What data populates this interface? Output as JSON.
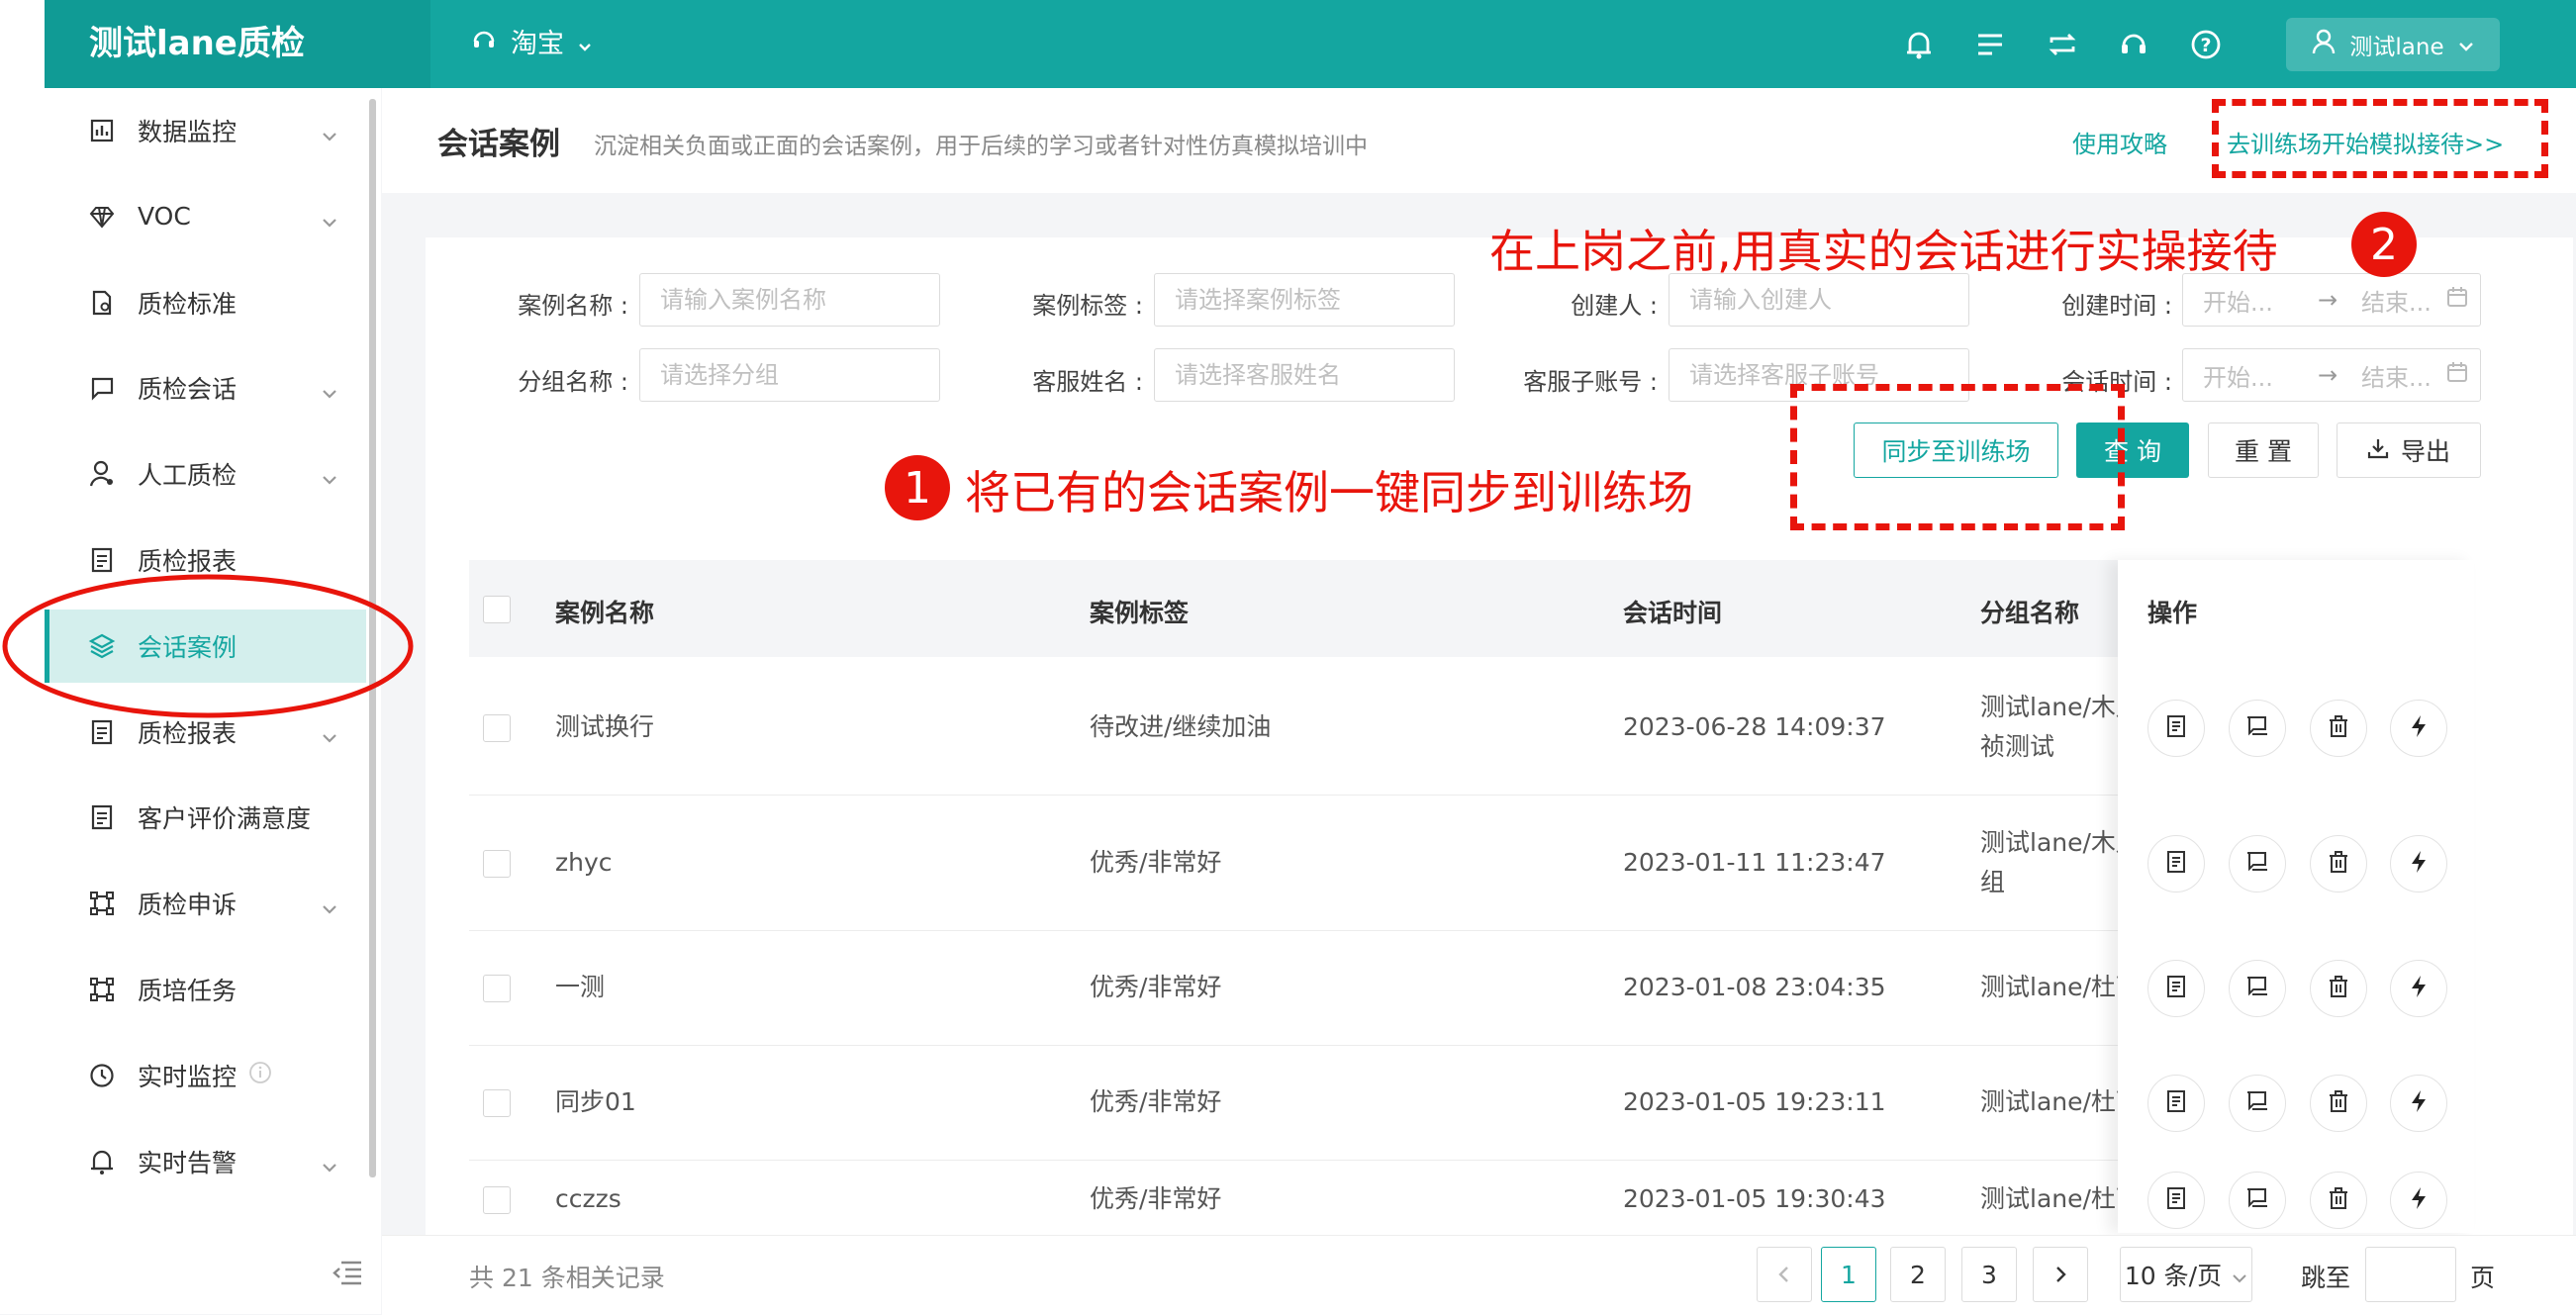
{
  "app": {
    "title": "测试lane质检",
    "store": "淘宝",
    "user": "测试lane"
  },
  "sidebar": {
    "items": [
      {
        "label": "数据监控",
        "icon": "bar-chart-icon",
        "expandable": true
      },
      {
        "label": "VOC",
        "icon": "diamond-icon",
        "expandable": true
      },
      {
        "label": "质检标准",
        "icon": "document-icon",
        "expandable": false
      },
      {
        "label": "质检会话",
        "icon": "chat-icon",
        "expandable": true
      },
      {
        "label": "人工质检",
        "icon": "person-icon",
        "expandable": true
      },
      {
        "label": "质检报表",
        "icon": "report-icon",
        "expandable": false
      },
      {
        "label": "会话案例",
        "icon": "layers-icon",
        "expandable": false,
        "active": true
      },
      {
        "label": "质检报表",
        "icon": "report-icon",
        "expandable": true
      },
      {
        "label": "客户评价满意度",
        "icon": "report-icon",
        "expandable": false
      },
      {
        "label": "质检申诉",
        "icon": "frame-icon",
        "expandable": true
      },
      {
        "label": "质培任务",
        "icon": "frame-icon",
        "expandable": false
      },
      {
        "label": "实时监控",
        "icon": "clock-icon",
        "expandable": false
      },
      {
        "label": "实时告警",
        "icon": "bell-icon",
        "expandable": true
      }
    ]
  },
  "header": {
    "title": "会话案例",
    "description": "沉淀相关负面或正面的会话案例，用于后续的学习或者针对性仿真模拟培训中",
    "guide_link": "使用攻略",
    "train_link": "去训练场开始模拟接待>>"
  },
  "filters": {
    "case_name": {
      "label": "案例名称 :",
      "placeholder": "请输入案例名称"
    },
    "case_tag": {
      "label": "案例标签 :",
      "placeholder": "请选择案例标签"
    },
    "creator": {
      "label": "创建人 :",
      "placeholder": "请输入创建人"
    },
    "create_time": {
      "label": "创建时间 :",
      "start": "开始...",
      "end": "结束..."
    },
    "group_name": {
      "label": "分组名称 :",
      "placeholder": "请选择分组"
    },
    "agent_name": {
      "label": "客服姓名 :",
      "placeholder": "请选择客服姓名"
    },
    "sub_account": {
      "label": "客服子账号 :",
      "placeholder": "请选择客服子账号"
    },
    "session_time": {
      "label": "会话时间 :",
      "start": "开始...",
      "end": "结束..."
    }
  },
  "actions": {
    "sync": "同步至训练场",
    "query": "查 询",
    "reset": "重 置",
    "export": "导出"
  },
  "table": {
    "headers": [
      "案例名称",
      "案例标签",
      "会话时间",
      "分组名称",
      "操作"
    ],
    "rows": [
      {
        "name": "测试换行",
        "tag": "待改进/继续加油",
        "time": "2023-06-28 14:09:37",
        "group": "测试lane/木月",
        "group2": "祯测试"
      },
      {
        "name": "zhyc",
        "tag": "优秀/非常好",
        "time": "2023-01-11 11:23:47",
        "group": "测试lane/木月",
        "group2": "组"
      },
      {
        "name": "一测",
        "tag": "优秀/非常好",
        "time": "2023-01-08 23:04:35",
        "group": "测试lane/杜可",
        "group2": ""
      },
      {
        "name": "同步01",
        "tag": "优秀/非常好",
        "time": "2023-01-05 19:23:11",
        "group": "测试lane/杜可",
        "group2": ""
      },
      {
        "name": "cczzs",
        "tag": "优秀/非常好",
        "time": "2023-01-05 19:30:43",
        "group": "测试lane/杜可",
        "group2": ""
      }
    ]
  },
  "pagination": {
    "total": "共 21 条相关记录",
    "pages": [
      "1",
      "2",
      "3"
    ],
    "page_size": "10 条/页",
    "goto": "跳至",
    "page_unit": "页"
  },
  "annotations": {
    "step1": "将已有的会话案例一键同步到训练场",
    "step1_num": "1",
    "step2": "在上岗之前,用真实的会话进行实操接待",
    "step2_num": "2"
  },
  "colors": {
    "brand": "#14a6a0",
    "annotation": "#e8150c"
  }
}
